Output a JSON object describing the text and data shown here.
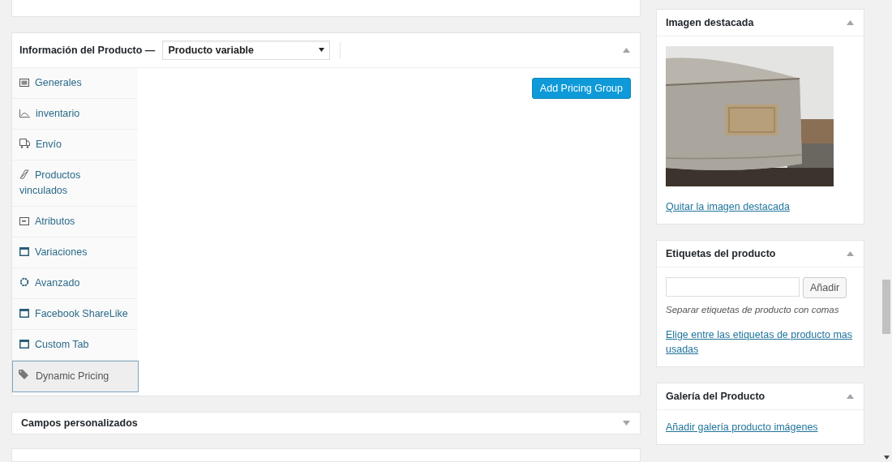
{
  "product_data": {
    "title": "Información del Producto —",
    "product_type": "Producto variable",
    "expanded": true,
    "tabs": [
      {
        "label": "Generales",
        "kind": "list",
        "selected": false
      },
      {
        "label": "inventario",
        "kind": "chart",
        "selected": false
      },
      {
        "label": "Envío",
        "kind": "truck",
        "selected": false
      },
      {
        "label": "Productos vinculados",
        "kind": "link",
        "selected": false
      },
      {
        "label": "Atributos",
        "kind": "box",
        "selected": false
      },
      {
        "label": "Variaciones",
        "kind": "window",
        "selected": false
      },
      {
        "label": "Avanzado",
        "kind": "gear",
        "selected": false
      },
      {
        "label": "Facebook ShareLike",
        "kind": "window",
        "selected": false
      },
      {
        "label": "Custom Tab",
        "kind": "window",
        "selected": false
      },
      {
        "label": "Dynamic Pricing",
        "kind": "tag",
        "selected": true
      }
    ],
    "button": "Add Pricing Group"
  },
  "custom_fields": {
    "title": "Campos personalizados",
    "expanded": false
  },
  "featured_image": {
    "title": "Imagen destacada",
    "expanded": true,
    "link": "Quitar la imagen destacada"
  },
  "product_tags": {
    "title": "Etiquetas del producto",
    "expanded": true,
    "button": "Añadir",
    "hint": "Separar etiquetas de producto con comas",
    "link": "Elige entre las etiquetas de producto mas usadas"
  },
  "product_gallery": {
    "title": "Galería del Producto",
    "expanded": true,
    "link": "Añadir galería producto imágenes"
  }
}
